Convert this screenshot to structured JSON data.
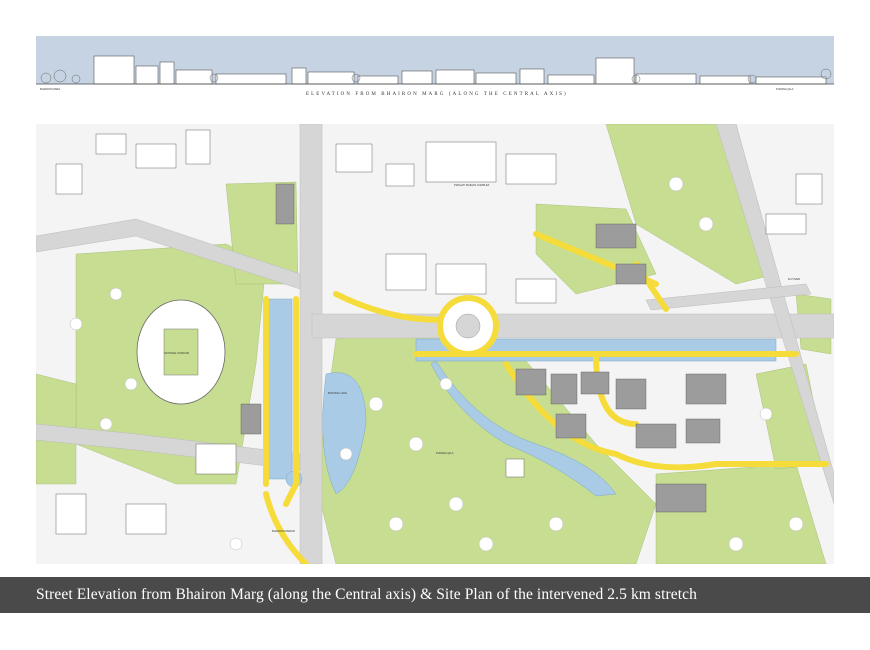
{
  "elevation": {
    "title": "ELEVATION FROM BHAIRON MARG (ALONG THE CENTRAL AXIS)",
    "left_label": "BHAIRON MARG",
    "right_label": "PURANA QILA"
  },
  "site_plan": {
    "labels": {
      "pragati": "PRAGATI MAIDAN COMPLEX",
      "stadium": "NATIONAL STADIUM",
      "purana_qila": "PURANA QILA",
      "boating_lake": "BOATING LAKE",
      "bhairon_mandir": "BHAIRON MANDIR",
      "flyover": "FLYOVER"
    }
  },
  "caption": "Street Elevation from Bhairon Marg (along the Central axis) & Site Plan of the intervened 2.5 km stretch",
  "colors": {
    "sky": "#c6d3e3",
    "water": "#a9cbe5",
    "green": "#c7dd92",
    "yellow": "#f5dc3b",
    "road": "#d6d6d6",
    "caption_bg": "#4a4a4a"
  }
}
